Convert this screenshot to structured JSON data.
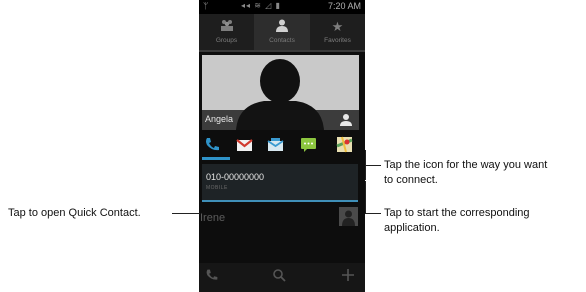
{
  "status_bar": {
    "time": "7:20 AM"
  },
  "tabs": [
    {
      "label": "Groups",
      "icon": "groups-icon"
    },
    {
      "label": "Contacts",
      "icon": "contacts-icon"
    },
    {
      "label": "Favorites",
      "icon": "favorites-icon"
    }
  ],
  "contact": {
    "name": "Angela",
    "phone": "010-00000000",
    "phone_type": "MOBILE"
  },
  "next_contact": {
    "name": "Irene"
  },
  "action_icons": [
    "phone-icon",
    "gmail-icon",
    "email-icon",
    "message-icon",
    "maps-icon"
  ],
  "bottom_bar_icons": [
    "phone-icon",
    "search-icon",
    "add-icon"
  ],
  "callouts": {
    "icon_way_line1": "Tap the icon for the way you want",
    "icon_way_line2": "to connect.",
    "quick_contact": "Tap to open Quick Contact.",
    "start_app_line1": "Tap to start the corresponding",
    "start_app_line2": "application."
  },
  "colors": {
    "accent_blue": "#2f93c9",
    "background": "#0d0d0d"
  }
}
